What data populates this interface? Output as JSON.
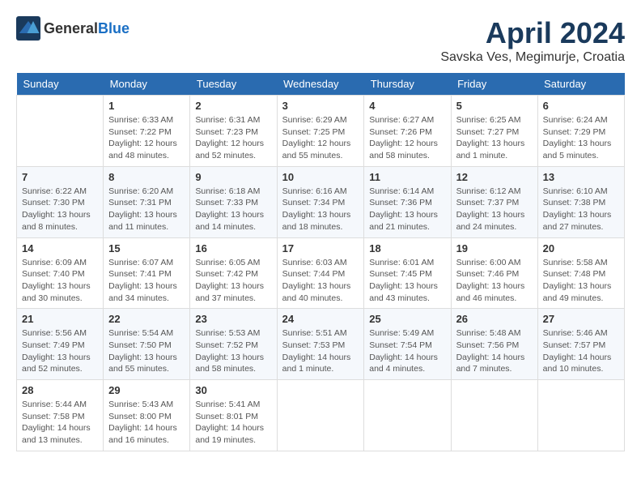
{
  "header": {
    "logo_general": "General",
    "logo_blue": "Blue",
    "title": "April 2024",
    "subtitle": "Savska Ves, Megimurje, Croatia"
  },
  "weekdays": [
    "Sunday",
    "Monday",
    "Tuesday",
    "Wednesday",
    "Thursday",
    "Friday",
    "Saturday"
  ],
  "weeks": [
    [
      {
        "day": "",
        "info": ""
      },
      {
        "day": "1",
        "info": "Sunrise: 6:33 AM\nSunset: 7:22 PM\nDaylight: 12 hours\nand 48 minutes."
      },
      {
        "day": "2",
        "info": "Sunrise: 6:31 AM\nSunset: 7:23 PM\nDaylight: 12 hours\nand 52 minutes."
      },
      {
        "day": "3",
        "info": "Sunrise: 6:29 AM\nSunset: 7:25 PM\nDaylight: 12 hours\nand 55 minutes."
      },
      {
        "day": "4",
        "info": "Sunrise: 6:27 AM\nSunset: 7:26 PM\nDaylight: 12 hours\nand 58 minutes."
      },
      {
        "day": "5",
        "info": "Sunrise: 6:25 AM\nSunset: 7:27 PM\nDaylight: 13 hours\nand 1 minute."
      },
      {
        "day": "6",
        "info": "Sunrise: 6:24 AM\nSunset: 7:29 PM\nDaylight: 13 hours\nand 5 minutes."
      }
    ],
    [
      {
        "day": "7",
        "info": "Sunrise: 6:22 AM\nSunset: 7:30 PM\nDaylight: 13 hours\nand 8 minutes."
      },
      {
        "day": "8",
        "info": "Sunrise: 6:20 AM\nSunset: 7:31 PM\nDaylight: 13 hours\nand 11 minutes."
      },
      {
        "day": "9",
        "info": "Sunrise: 6:18 AM\nSunset: 7:33 PM\nDaylight: 13 hours\nand 14 minutes."
      },
      {
        "day": "10",
        "info": "Sunrise: 6:16 AM\nSunset: 7:34 PM\nDaylight: 13 hours\nand 18 minutes."
      },
      {
        "day": "11",
        "info": "Sunrise: 6:14 AM\nSunset: 7:36 PM\nDaylight: 13 hours\nand 21 minutes."
      },
      {
        "day": "12",
        "info": "Sunrise: 6:12 AM\nSunset: 7:37 PM\nDaylight: 13 hours\nand 24 minutes."
      },
      {
        "day": "13",
        "info": "Sunrise: 6:10 AM\nSunset: 7:38 PM\nDaylight: 13 hours\nand 27 minutes."
      }
    ],
    [
      {
        "day": "14",
        "info": "Sunrise: 6:09 AM\nSunset: 7:40 PM\nDaylight: 13 hours\nand 30 minutes."
      },
      {
        "day": "15",
        "info": "Sunrise: 6:07 AM\nSunset: 7:41 PM\nDaylight: 13 hours\nand 34 minutes."
      },
      {
        "day": "16",
        "info": "Sunrise: 6:05 AM\nSunset: 7:42 PM\nDaylight: 13 hours\nand 37 minutes."
      },
      {
        "day": "17",
        "info": "Sunrise: 6:03 AM\nSunset: 7:44 PM\nDaylight: 13 hours\nand 40 minutes."
      },
      {
        "day": "18",
        "info": "Sunrise: 6:01 AM\nSunset: 7:45 PM\nDaylight: 13 hours\nand 43 minutes."
      },
      {
        "day": "19",
        "info": "Sunrise: 6:00 AM\nSunset: 7:46 PM\nDaylight: 13 hours\nand 46 minutes."
      },
      {
        "day": "20",
        "info": "Sunrise: 5:58 AM\nSunset: 7:48 PM\nDaylight: 13 hours\nand 49 minutes."
      }
    ],
    [
      {
        "day": "21",
        "info": "Sunrise: 5:56 AM\nSunset: 7:49 PM\nDaylight: 13 hours\nand 52 minutes."
      },
      {
        "day": "22",
        "info": "Sunrise: 5:54 AM\nSunset: 7:50 PM\nDaylight: 13 hours\nand 55 minutes."
      },
      {
        "day": "23",
        "info": "Sunrise: 5:53 AM\nSunset: 7:52 PM\nDaylight: 13 hours\nand 58 minutes."
      },
      {
        "day": "24",
        "info": "Sunrise: 5:51 AM\nSunset: 7:53 PM\nDaylight: 14 hours\nand 1 minute."
      },
      {
        "day": "25",
        "info": "Sunrise: 5:49 AM\nSunset: 7:54 PM\nDaylight: 14 hours\nand 4 minutes."
      },
      {
        "day": "26",
        "info": "Sunrise: 5:48 AM\nSunset: 7:56 PM\nDaylight: 14 hours\nand 7 minutes."
      },
      {
        "day": "27",
        "info": "Sunrise: 5:46 AM\nSunset: 7:57 PM\nDaylight: 14 hours\nand 10 minutes."
      }
    ],
    [
      {
        "day": "28",
        "info": "Sunrise: 5:44 AM\nSunset: 7:58 PM\nDaylight: 14 hours\nand 13 minutes."
      },
      {
        "day": "29",
        "info": "Sunrise: 5:43 AM\nSunset: 8:00 PM\nDaylight: 14 hours\nand 16 minutes."
      },
      {
        "day": "30",
        "info": "Sunrise: 5:41 AM\nSunset: 8:01 PM\nDaylight: 14 hours\nand 19 minutes."
      },
      {
        "day": "",
        "info": ""
      },
      {
        "day": "",
        "info": ""
      },
      {
        "day": "",
        "info": ""
      },
      {
        "day": "",
        "info": ""
      }
    ]
  ]
}
